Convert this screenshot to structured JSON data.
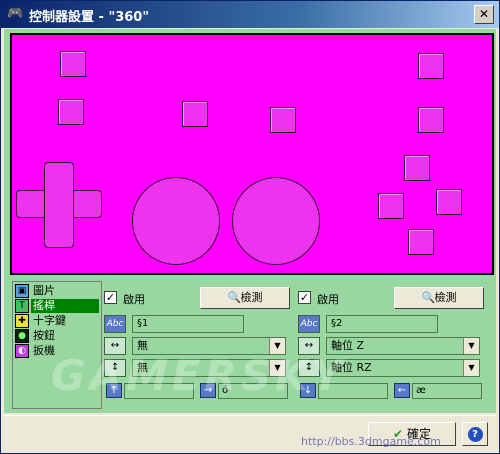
{
  "window": {
    "title": "控制器設置 - \"360\"",
    "close_label": "✕"
  },
  "tree": {
    "items": [
      {
        "label": "圖片",
        "icon": "picture-icon"
      },
      {
        "label": "搖桿",
        "icon": "joystick-icon",
        "selected": true
      },
      {
        "label": "十字鍵",
        "icon": "dpad-icon"
      },
      {
        "label": "按鈕",
        "icon": "button-icon"
      },
      {
        "label": "扳機",
        "icon": "trigger-icon"
      }
    ]
  },
  "left_stick": {
    "enabled_label": "啟用",
    "enabled": true,
    "detect_label": "檢測",
    "name_icon": "Abc",
    "name_value": "§1",
    "x_axis": "無",
    "y_axis": "無",
    "field_up": "",
    "field_right": "ó"
  },
  "right_stick": {
    "enabled_label": "啟用",
    "enabled": true,
    "detect_label": "檢測",
    "name_icon": "Abc",
    "name_value": "§2",
    "x_axis": "軸位 Z",
    "y_axis": "軸位 RZ",
    "field_down": "",
    "field_left": "æ"
  },
  "footer": {
    "ok_label": "確定",
    "help_label": "?"
  },
  "overlay": {
    "watermark": "GAMERSKY",
    "url": "http://bbs.3dmgame.com"
  },
  "colors": {
    "preview_bg": "#ff00ff",
    "panel_bg": "#98d8a0",
    "selected": "#008000"
  }
}
